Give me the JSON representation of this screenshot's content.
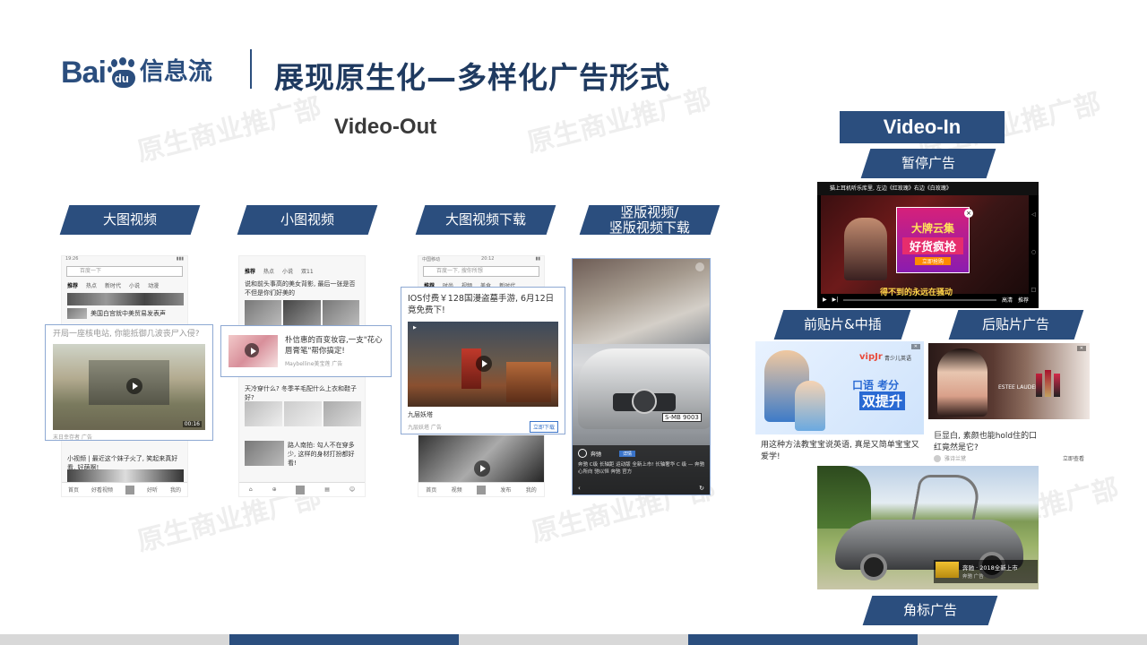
{
  "header": {
    "logo_bai": "Bai",
    "logo_du": "du",
    "logo_cn": "信息流",
    "title": "展现原生化—多样化广告形式"
  },
  "watermark": "原生商业推广部",
  "video_out": {
    "title": "Video-Out",
    "labels": [
      "大图视频",
      "小图视频",
      "大图视频下载",
      "竖版视频/\n竖版视频下载"
    ]
  },
  "phone1": {
    "status_time": "19:26",
    "search_placeholder": "百度一下",
    "tabs": [
      "推荐",
      "热点",
      "新时代",
      "小说",
      "动漫",
      "视频"
    ],
    "news_text": "美国白宫就中美贸易发表声",
    "ad_title": "开局一座核电站, 你能抵御几波丧尸入侵?",
    "duration": "00:16",
    "ad_meta": "末日幸存者  广告",
    "next_text": "小视频 | 最近这个妹子火了, 笑起来真好看, 好萌啊!",
    "bottom": [
      "首页",
      "好看视频",
      "",
      "好听",
      "我的"
    ]
  },
  "phone2": {
    "tabs": [
      "推荐",
      "热点",
      "小说",
      "双11"
    ],
    "news1": "说和前头事高的美女背影, 最后一张是否不但是你们好美的",
    "ad_title": "朴信惠的百变妆容,一支\"花心唇膏笔\"帮你搞定!",
    "ad_meta": "Maybelline美宝莲  广告",
    "news2": "天冷穿什么? 冬季羊毛配什么上衣和鞋子好?",
    "news3": "路人南拍: 勾人不在穿多少, 这样的身材打扮都好看!",
    "bottom": [
      "首页",
      "",
      "",
      "",
      "我的"
    ]
  },
  "phone3": {
    "status_carrier": "中国移动",
    "status_time": "20:12",
    "search_placeholder": "百度一下, 搜你所想",
    "tabs": [
      "推荐",
      "时尚",
      "视频",
      "美食",
      "新时代"
    ],
    "ad_title": "IOS付费￥128国漫盗墓手游, 6月12日竟免费下!",
    "app_name": "九层妖塔",
    "ad_meta": "九层妖塔  广告",
    "download": "立即下载",
    "bottom": [
      "首页",
      "视频",
      "",
      "发布",
      "我的"
    ]
  },
  "phone4": {
    "brand": "奔驰",
    "brand_btn": "详情",
    "caption": "奔驰 C级 长轴距 运动版 全新上市! 长轴奢华 C 级 — 奔驰 心所向 驰以恒 奔驰 官方",
    "plate": "S-MB 9003"
  },
  "video_in": {
    "title": "Video-In",
    "labels": {
      "pause": "暂停广告",
      "pre_mid": "前贴片&中插",
      "post": "后贴片广告",
      "corner": "角标广告"
    },
    "pause_ad": {
      "top_title": "猫上耳机听乐库里, 左边《红玫瑰》右边《白玫瑰》",
      "banner_line1": "大牌云集",
      "banner_line2": "好货疯抢",
      "banner_btn": "立即抢购",
      "subtitle": "得不到的永远在骚动",
      "controls": [
        "高清",
        "推荐"
      ]
    },
    "pre_ad": {
      "brand": "vipJr",
      "brand_sub": "青少儿英语",
      "line1": "口语 考分",
      "line2": "双提升",
      "caption": "用这种方法教宝宝说英语, 真是又简单宝宝又爱学!"
    },
    "post_ad": {
      "brand": "ESTEE LAUDER",
      "caption": "巨显白, 素颜也能hold住的口红竟然是它?",
      "meta": "雅诗兰黛",
      "btn": "立即查看"
    },
    "corner_ad": {
      "badge": "奔驰 · 2018全新上市",
      "sub": "奔驰  广告"
    }
  },
  "colors": {
    "navy": "#2b4e7e",
    "highlight_border": "#8ea9d3"
  }
}
